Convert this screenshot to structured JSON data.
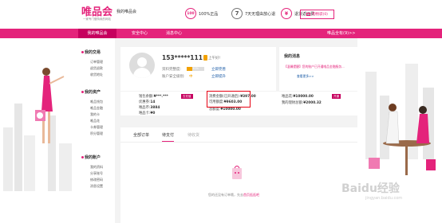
{
  "header": {
    "logo": "唯品会",
    "logo_sub": "一家专门做特卖的网站",
    "my_center": "我的唯品会",
    "badges": [
      {
        "icon": "100",
        "text": "100%正品"
      },
      {
        "icon": "7",
        "text": "7天无理由放心退"
      },
      {
        "icon": "¥",
        "text": "退货返运费"
      }
    ],
    "cart": "购物袋(0)"
  },
  "nav": {
    "items": [
      "我的唯品会",
      "安全中心",
      "消息中心"
    ],
    "right": "唯品全有(9)>>"
  },
  "sidebar": {
    "sections": [
      {
        "title": "我的交易",
        "items": [
          "订单管理",
          "退货退款",
          "收货地址"
        ]
      },
      {
        "title": "我的资产",
        "items": [
          "唯品钱包",
          "唯品金融",
          "我的卡",
          "唯品花",
          "卡券管理",
          "积分管理"
        ]
      },
      {
        "title": "我的账户",
        "items": [
          "我的资料",
          "分享账号",
          "修改密码",
          "消息设置"
        ]
      }
    ]
  },
  "profile": {
    "phone": "153*****111",
    "greeting": "上午好!",
    "completeness_label": "资料完整度:",
    "completeness_value": "30%",
    "completeness_fraction": 0.3,
    "completeness_link": "立即完善",
    "security_label": "账户安全级别:",
    "security_value": "中",
    "security_link": "立即提升"
  },
  "messages": {
    "title": "我的消息",
    "line": "【温馨提醒】您的账户已开通唯品金融服务...",
    "more": "查看更多>>"
  },
  "stats": {
    "wallet_balance_label": "钱包余额:",
    "wallet_balance": "¥***.***",
    "discount_label": "优惠券:",
    "discount_value": "14",
    "points_label": "唯品币:",
    "points_value": "3884",
    "card_label": "唯品卡:",
    "card_value": "¥0",
    "recharge_tag": "去充值",
    "consume_total_label": "消费金额(已开通后):",
    "consume_total": "¥397.00",
    "available_label": "可用额度:",
    "available_value": "¥9603.00",
    "total_label": "总额度:",
    "total_value": "¥10000.00",
    "vip_label": "唯品花:",
    "vip_value": "¥10000.00",
    "vip_tag": "开通",
    "finance_label": "我的理财总额:",
    "finance_value": "¥2000.32"
  },
  "orders": {
    "tabs": [
      "全部订单",
      "待支付",
      "待收货"
    ],
    "empty_text": "您的还没有订单哦，先去",
    "empty_link": "首页逛逛吧"
  },
  "watermark": {
    "brand": "Baidu经验",
    "url": "jingyan.baidu.com"
  },
  "colors": {
    "brand": "#e4237b",
    "nav_active": "#c6005e",
    "highlight_border": "#e60012",
    "link": "#1a5ba6"
  }
}
